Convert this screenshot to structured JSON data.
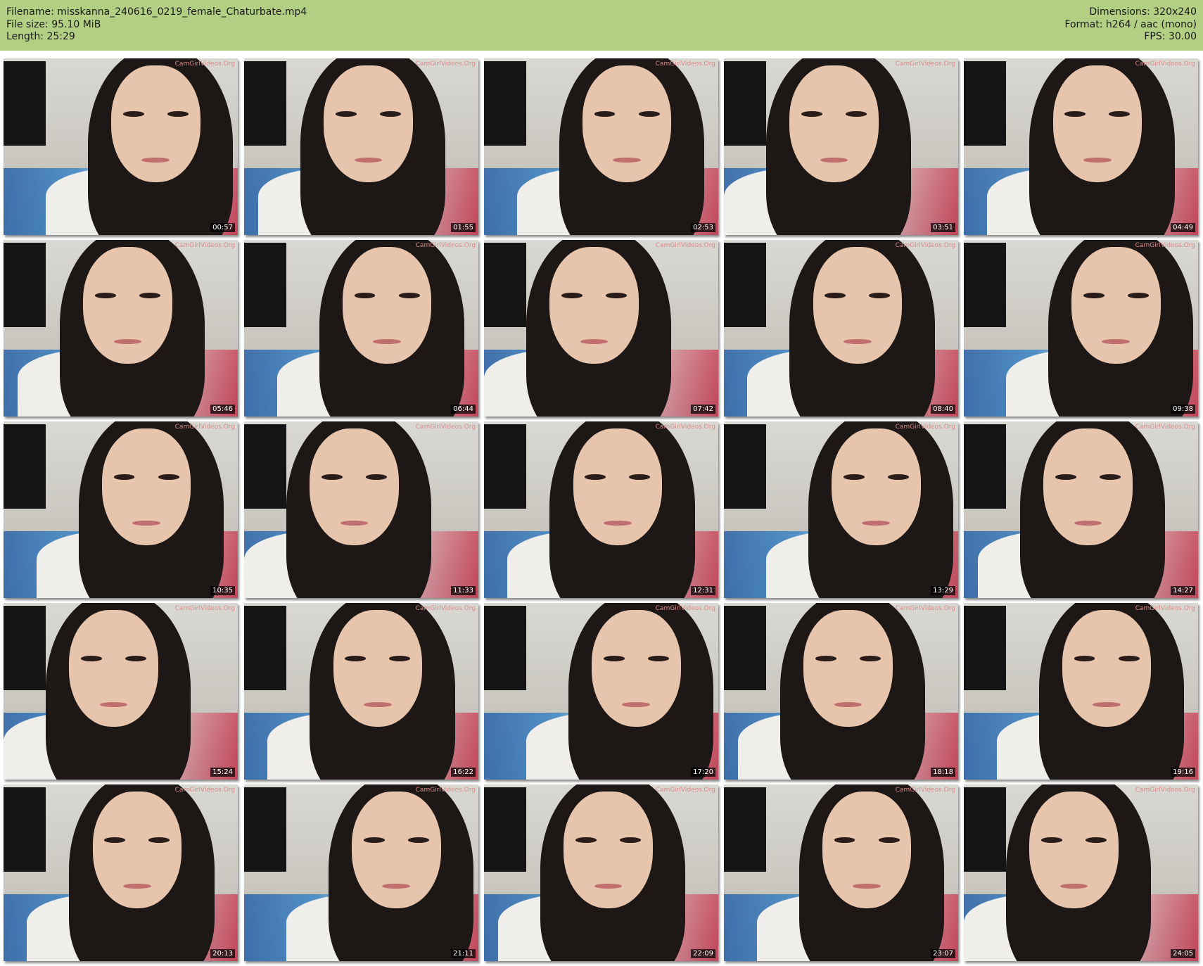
{
  "header": {
    "filename_label": "Filename: misskanna_240616_0219_female_Chaturbate.mp4",
    "filesize_label": "File size: 95.10 MiB",
    "length_label": "Length: 25:29",
    "dimensions_label": "Dimensions: 320x240",
    "format_label": "Format: h264 / aac (mono)",
    "fps_label": "FPS: 30.00",
    "background_color": "#b3cf84"
  },
  "thumbnails": {
    "watermark": "CamGirlVideos.Org",
    "timestamps": [
      "00:57",
      "01:55",
      "02:53",
      "03:51",
      "04:49",
      "05:46",
      "06:44",
      "07:42",
      "08:40",
      "09:38",
      "10:35",
      "11:33",
      "12:31",
      "13:29",
      "14:27",
      "15:24",
      "16:22",
      "17:20",
      "18:18",
      "19:16",
      "20:13",
      "21:11",
      "22:09",
      "23:07",
      "24:05"
    ]
  }
}
